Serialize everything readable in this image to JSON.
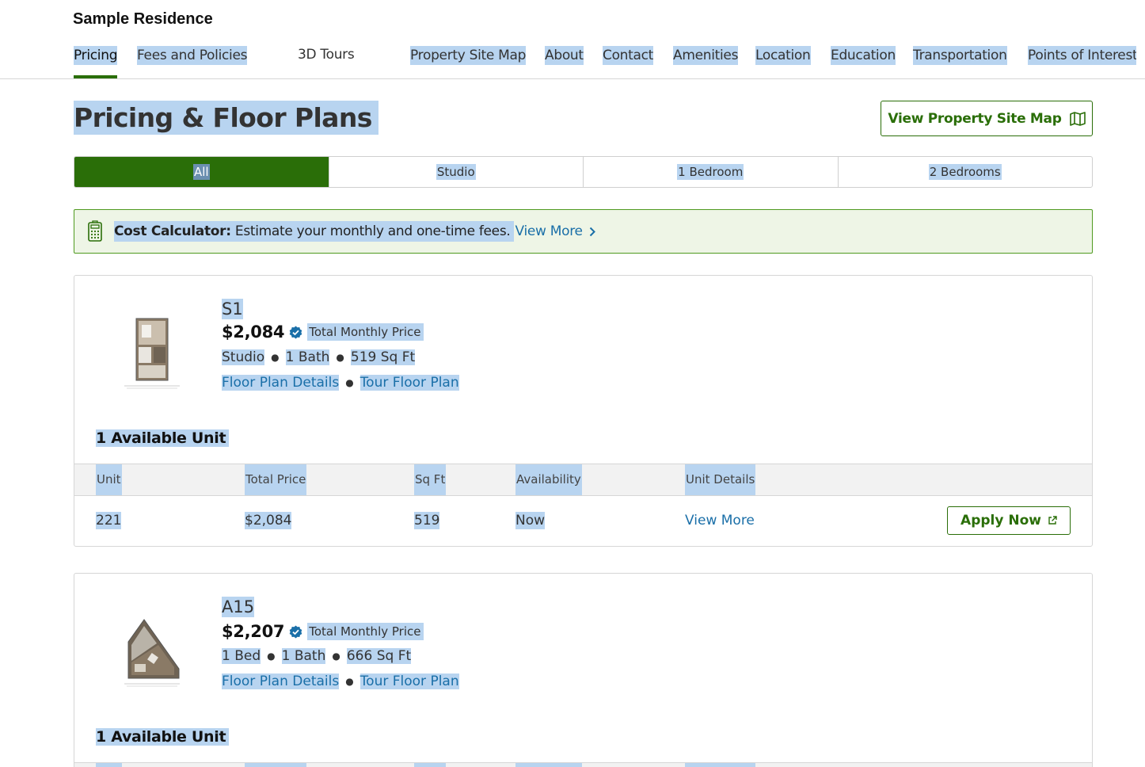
{
  "site": {
    "title": "Sample Residence"
  },
  "nav": {
    "items": [
      {
        "label": "Pricing"
      },
      {
        "label": "Fees and Policies"
      },
      {
        "label": "3D Tours"
      },
      {
        "label": "Property Site Map"
      },
      {
        "label": "About"
      },
      {
        "label": "Contact"
      },
      {
        "label": "Amenities"
      },
      {
        "label": "Location"
      },
      {
        "label": "Education"
      },
      {
        "label": "Transportation"
      },
      {
        "label": "Points of Interest"
      }
    ]
  },
  "header": {
    "title": "Pricing & Floor Plans",
    "site_map_button": "View Property Site Map",
    "site_map_icon": "map-icon"
  },
  "filters": {
    "tabs": [
      {
        "label": "All",
        "active": true
      },
      {
        "label": "Studio"
      },
      {
        "label": "1 Bedroom"
      },
      {
        "label": "2 Bedrooms"
      }
    ]
  },
  "calculator": {
    "icon": "calculator-icon",
    "label": "Cost Calculator:",
    "text": "Estimate your monthly and one-time fees.",
    "link": "View More"
  },
  "table_headers": [
    "Unit",
    "Total Price",
    "Sq Ft",
    "Availability",
    "Unit Details"
  ],
  "floor_plans": [
    {
      "name": "S1",
      "price": "$2,084",
      "price_label": "Total Monthly Price",
      "specs": [
        "Studio",
        "1 Bath",
        "519 Sq Ft"
      ],
      "links": [
        "Floor Plan Details",
        "Tour Floor Plan"
      ],
      "available": "1 Available Unit",
      "units": [
        {
          "unit": "221",
          "price": "$2,084",
          "sqft": "519",
          "availability": "Now",
          "details": "View More",
          "apply": "Apply Now"
        }
      ]
    },
    {
      "name": "A15",
      "price": "$2,207",
      "price_label": "Total Monthly Price",
      "specs": [
        "1 Bed",
        "1 Bath",
        "666 Sq Ft"
      ],
      "links": [
        "Floor Plan Details",
        "Tour Floor Plan"
      ],
      "available": "1 Available Unit"
    }
  ],
  "colors": {
    "brand_green": "#2a6e08",
    "link_blue": "#1a6fa8",
    "selection": "#b8d4f0"
  }
}
